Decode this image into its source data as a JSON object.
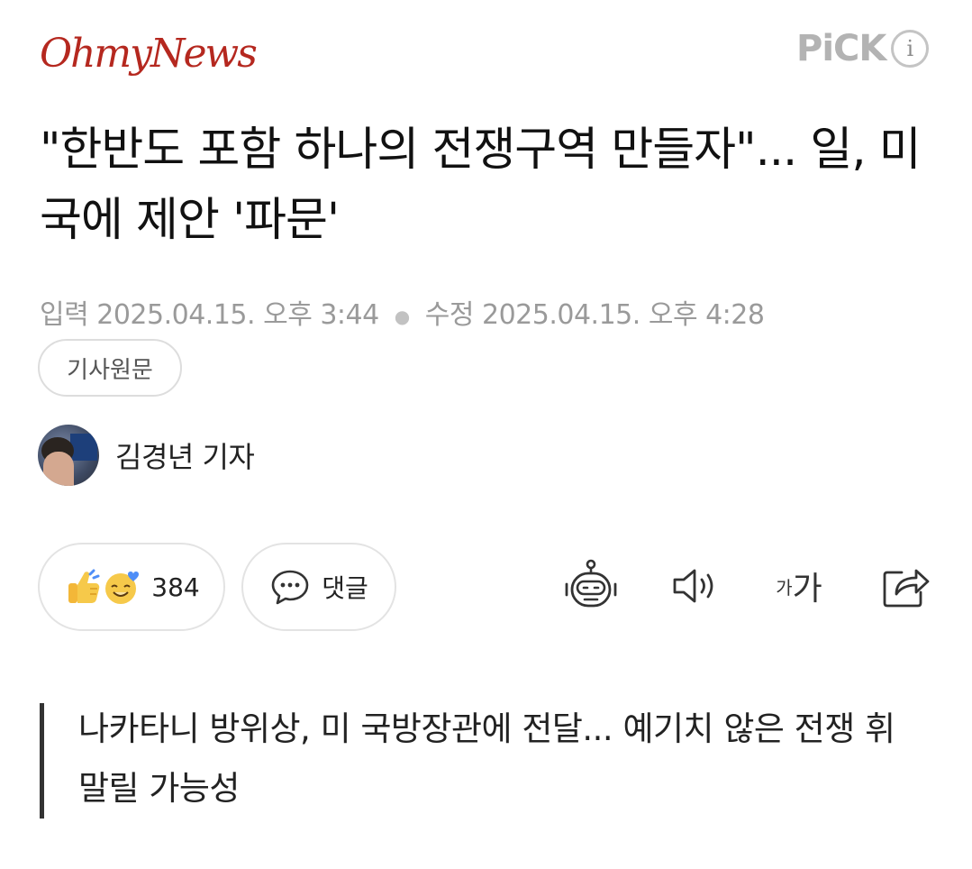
{
  "header": {
    "publisher": "OhmyNews",
    "pick_label": "PiCK",
    "info_label": "i"
  },
  "article": {
    "headline": "\"한반도 포함 하나의 전쟁구역 만들자\"... 일, 미국에 제안 '파문'",
    "published_label": "입력",
    "published": "2025.04.15. 오후 3:44",
    "modified_label": "수정",
    "modified": "2025.04.15. 오후 4:28",
    "source_button": "기사원문",
    "reporter": "김경년 기자",
    "summary": "나카타니 방위상, 미 국방장관에 전달... 예기치 않은 전쟁 휘말릴 가능성"
  },
  "actions": {
    "reaction_count": "384",
    "comment_label": "댓글",
    "font_small": "가",
    "font_big": "가"
  },
  "colors": {
    "brand": "#b5281f",
    "muted": "#9a9a9a",
    "border": "#e3e3e3",
    "reaction_yellow": "#f6c94a",
    "reaction_blue": "#4f8ef7"
  },
  "icons": [
    "thumbs-up-icon",
    "smile-heart-icon",
    "comment-bubble-icon",
    "robot-summary-icon",
    "speaker-icon",
    "font-size-icon",
    "share-icon",
    "info-icon"
  ]
}
